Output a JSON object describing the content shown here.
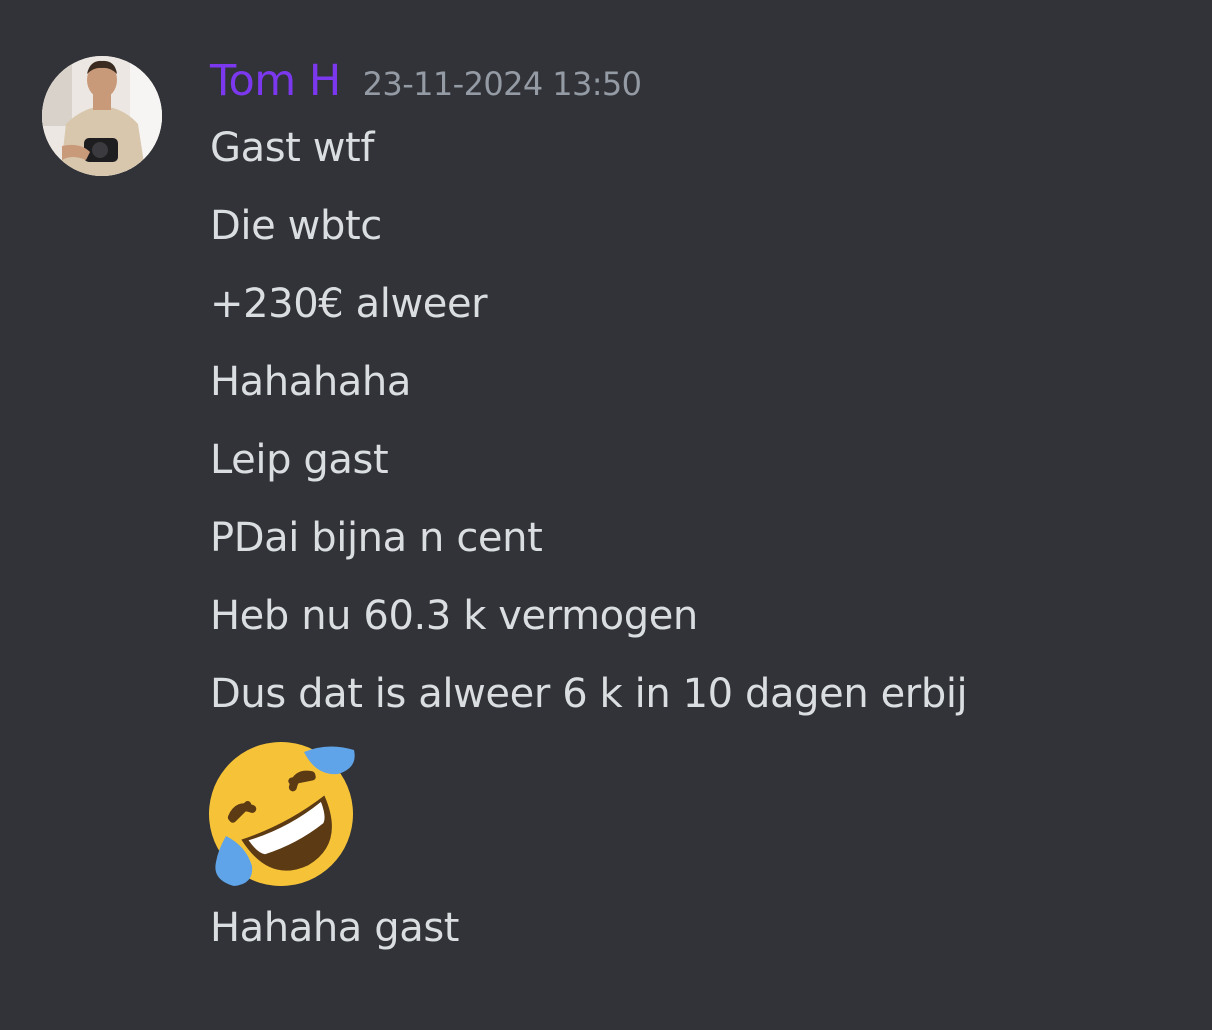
{
  "message": {
    "author": "Tom H",
    "timestamp": "23-11-2024 13:50",
    "author_color": "#7b38ee",
    "lines_before_emoji": [
      "Gast wtf",
      "Die wbtc",
      "+230€ alweer",
      "Hahahaha",
      "Leip gast",
      "PDai bijna n cent",
      "Heb nu 60.3 k vermogen",
      "Dus dat is alweer 6 k in 10 dagen erbij"
    ],
    "emoji": "rolling-on-the-floor-laughing-emoji",
    "lines_after_emoji": [
      "Hahaha gast"
    ]
  }
}
